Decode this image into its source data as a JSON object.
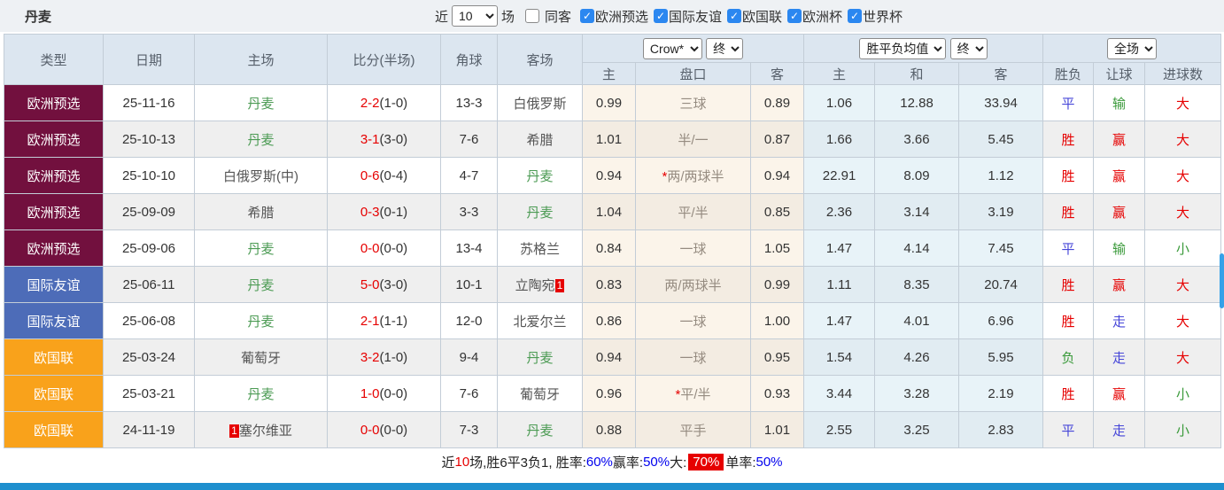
{
  "topbar": {
    "title": "丹麦",
    "recent_label": "近",
    "recent_value": "10",
    "matches_label": "场",
    "same_venue_label": "同客",
    "filters": [
      {
        "label": "欧洲预选",
        "checked": true
      },
      {
        "label": "国际友谊",
        "checked": true
      },
      {
        "label": "欧国联",
        "checked": true
      },
      {
        "label": "欧洲杯",
        "checked": true
      },
      {
        "label": "世界杯",
        "checked": true
      }
    ]
  },
  "table": {
    "col_headers": [
      "类型",
      "日期",
      "主场",
      "比分(半场)",
      "角球",
      "客场"
    ],
    "dropdowns": {
      "company": "Crow*",
      "company_time": "终",
      "wdl": "胜平负均值",
      "wdl_time": "终",
      "scope": "全场"
    },
    "sub_headers": [
      "主",
      "盘口",
      "客",
      "主",
      "和",
      "客",
      "胜负",
      "让球",
      "进球数"
    ],
    "type_colors": {
      "欧洲预选": "#72103e",
      "国际友谊": "#4d6cb8",
      "欧国联": "#f9a21b"
    },
    "rows": [
      {
        "type": "欧洲预选",
        "date": "25-11-16",
        "home": "丹麦",
        "home_focus": true,
        "home_badge": "",
        "score": "2-2",
        "half": "(1-0)",
        "corner": "13-3",
        "away": "白俄罗斯",
        "away_focus": false,
        "away_badge": "",
        "odds_home": "0.99",
        "handicap_star": false,
        "handicap": "三球",
        "odds_away": "0.89",
        "wdl_home": "1.06",
        "wdl_draw": "12.88",
        "wdl_away": "33.94",
        "result": "平",
        "result_color": "blue",
        "give": "输",
        "give_color": "green",
        "goals": "大",
        "goals_color": "red"
      },
      {
        "type": "欧洲预选",
        "date": "25-10-13",
        "home": "丹麦",
        "home_focus": true,
        "home_badge": "",
        "score": "3-1",
        "half": "(3-0)",
        "corner": "7-6",
        "away": "希腊",
        "away_focus": false,
        "away_badge": "",
        "odds_home": "1.01",
        "handicap_star": false,
        "handicap": "半/一",
        "odds_away": "0.87",
        "wdl_home": "1.66",
        "wdl_draw": "3.66",
        "wdl_away": "5.45",
        "result": "胜",
        "result_color": "red",
        "give": "赢",
        "give_color": "red",
        "goals": "大",
        "goals_color": "red"
      },
      {
        "type": "欧洲预选",
        "date": "25-10-10",
        "home": "白俄罗斯(中)",
        "home_focus": false,
        "home_badge": "",
        "score": "0-6",
        "half": "(0-4)",
        "corner": "4-7",
        "away": "丹麦",
        "away_focus": true,
        "away_badge": "",
        "odds_home": "0.94",
        "handicap_star": true,
        "handicap": "两/两球半",
        "odds_away": "0.94",
        "wdl_home": "22.91",
        "wdl_draw": "8.09",
        "wdl_away": "1.12",
        "result": "胜",
        "result_color": "red",
        "give": "赢",
        "give_color": "red",
        "goals": "大",
        "goals_color": "red"
      },
      {
        "type": "欧洲预选",
        "date": "25-09-09",
        "home": "希腊",
        "home_focus": false,
        "home_badge": "",
        "score": "0-3",
        "half": "(0-1)",
        "corner": "3-3",
        "away": "丹麦",
        "away_focus": true,
        "away_badge": "",
        "odds_home": "1.04",
        "handicap_star": false,
        "handicap": "平/半",
        "odds_away": "0.85",
        "wdl_home": "2.36",
        "wdl_draw": "3.14",
        "wdl_away": "3.19",
        "result": "胜",
        "result_color": "red",
        "give": "赢",
        "give_color": "red",
        "goals": "大",
        "goals_color": "red"
      },
      {
        "type": "欧洲预选",
        "date": "25-09-06",
        "home": "丹麦",
        "home_focus": true,
        "home_badge": "",
        "score": "0-0",
        "half": "(0-0)",
        "corner": "13-4",
        "away": "苏格兰",
        "away_focus": false,
        "away_badge": "",
        "odds_home": "0.84",
        "handicap_star": false,
        "handicap": "一球",
        "odds_away": "1.05",
        "wdl_home": "1.47",
        "wdl_draw": "4.14",
        "wdl_away": "7.45",
        "result": "平",
        "result_color": "blue",
        "give": "输",
        "give_color": "green",
        "goals": "小",
        "goals_color": "green"
      },
      {
        "type": "国际友谊",
        "date": "25-06-11",
        "home": "丹麦",
        "home_focus": true,
        "home_badge": "",
        "score": "5-0",
        "half": "(3-0)",
        "corner": "10-1",
        "away": "立陶宛",
        "away_focus": false,
        "away_badge": "1",
        "odds_home": "0.83",
        "handicap_star": false,
        "handicap": "两/两球半",
        "odds_away": "0.99",
        "wdl_home": "1.11",
        "wdl_draw": "8.35",
        "wdl_away": "20.74",
        "result": "胜",
        "result_color": "red",
        "give": "赢",
        "give_color": "red",
        "goals": "大",
        "goals_color": "red"
      },
      {
        "type": "国际友谊",
        "date": "25-06-08",
        "home": "丹麦",
        "home_focus": true,
        "home_badge": "",
        "score": "2-1",
        "half": "(1-1)",
        "corner": "12-0",
        "away": "北爱尔兰",
        "away_focus": false,
        "away_badge": "",
        "odds_home": "0.86",
        "handicap_star": false,
        "handicap": "一球",
        "odds_away": "1.00",
        "wdl_home": "1.47",
        "wdl_draw": "4.01",
        "wdl_away": "6.96",
        "result": "胜",
        "result_color": "red",
        "give": "走",
        "give_color": "blue",
        "goals": "大",
        "goals_color": "red"
      },
      {
        "type": "欧国联",
        "date": "25-03-24",
        "home": "葡萄牙",
        "home_focus": false,
        "home_badge": "",
        "score": "3-2",
        "half": "(1-0)",
        "corner": "9-4",
        "away": "丹麦",
        "away_focus": true,
        "away_badge": "",
        "odds_home": "0.94",
        "handicap_star": false,
        "handicap": "一球",
        "odds_away": "0.95",
        "wdl_home": "1.54",
        "wdl_draw": "4.26",
        "wdl_away": "5.95",
        "result": "负",
        "result_color": "green",
        "give": "走",
        "give_color": "blue",
        "goals": "大",
        "goals_color": "red"
      },
      {
        "type": "欧国联",
        "date": "25-03-21",
        "home": "丹麦",
        "home_focus": true,
        "home_badge": "",
        "score": "1-0",
        "half": "(0-0)",
        "corner": "7-6",
        "away": "葡萄牙",
        "away_focus": false,
        "away_badge": "",
        "odds_home": "0.96",
        "handicap_star": true,
        "handicap": "平/半",
        "odds_away": "0.93",
        "wdl_home": "3.44",
        "wdl_draw": "3.28",
        "wdl_away": "2.19",
        "result": "胜",
        "result_color": "red",
        "give": "赢",
        "give_color": "red",
        "goals": "小",
        "goals_color": "green"
      },
      {
        "type": "欧国联",
        "date": "24-11-19",
        "home": "塞尔维亚",
        "home_focus": false,
        "home_badge": "1",
        "score": "0-0",
        "half": "(0-0)",
        "corner": "7-3",
        "away": "丹麦",
        "away_focus": true,
        "away_badge": "",
        "odds_home": "0.88",
        "handicap_star": false,
        "handicap": "平手",
        "odds_away": "1.01",
        "wdl_home": "2.55",
        "wdl_draw": "3.25",
        "wdl_away": "2.83",
        "result": "平",
        "result_color": "blue",
        "give": "走",
        "give_color": "blue",
        "goals": "小",
        "goals_color": "green"
      }
    ]
  },
  "footer": {
    "segments": [
      {
        "text": "近",
        "style": "black"
      },
      {
        "text": "10",
        "style": "red"
      },
      {
        "text": "场,胜6平3负1, 胜率:",
        "style": "black"
      },
      {
        "text": "60%",
        "style": "blue"
      },
      {
        "text": " 赢率:",
        "style": "black"
      },
      {
        "text": "50%",
        "style": "blue"
      },
      {
        "text": " 大:",
        "style": "black"
      },
      {
        "text": "70%",
        "style": "badge"
      },
      {
        "text": " 单率:",
        "style": "black"
      },
      {
        "text": "50%",
        "style": "blue"
      }
    ]
  }
}
